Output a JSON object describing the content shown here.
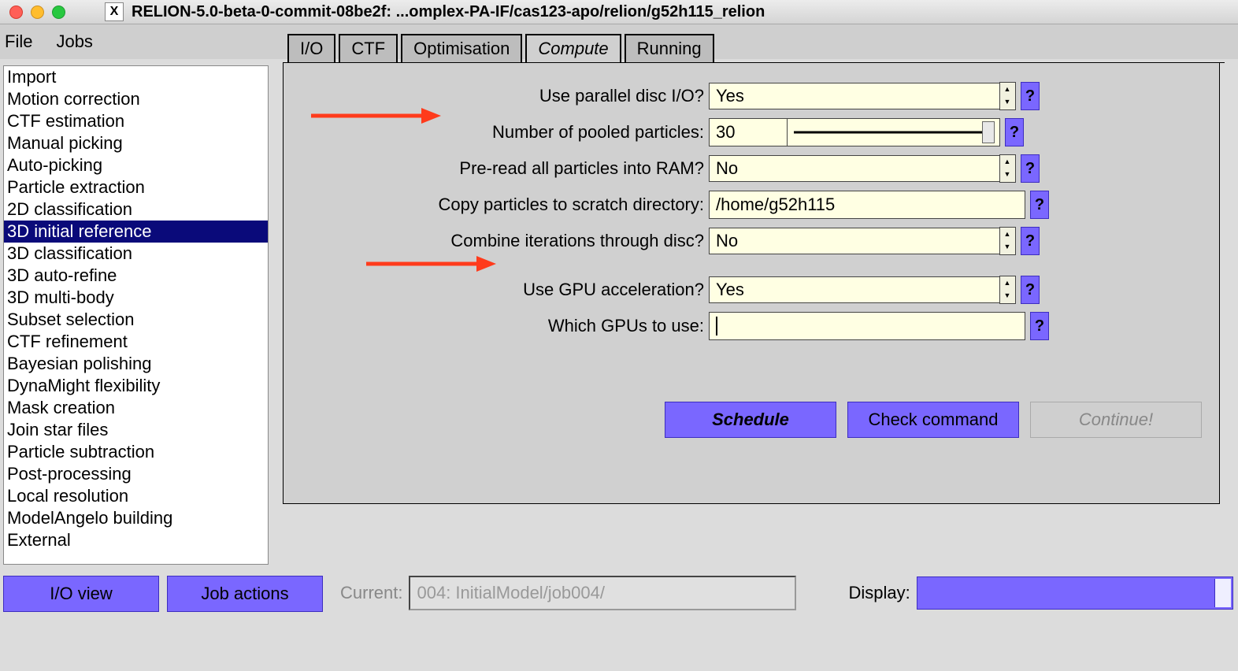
{
  "titlebar": {
    "title": "RELION-5.0-beta-0-commit-08be2f: ...omplex-PA-IF/cas123-apo/relion/g52h115_relion"
  },
  "menubar": {
    "items": [
      "File",
      "Jobs"
    ]
  },
  "jobtypes": {
    "items": [
      "Import",
      "Motion correction",
      "CTF estimation",
      "Manual picking",
      "Auto-picking",
      "Particle extraction",
      "2D classification",
      "3D initial reference",
      "3D classification",
      "3D auto-refine",
      "3D multi-body",
      "Subset selection",
      "CTF refinement",
      "Bayesian polishing",
      "DynaMight flexibility",
      "Mask creation",
      "Join star files",
      "Particle subtraction",
      "Post-processing",
      "Local resolution",
      "ModelAngelo building",
      "External"
    ],
    "selected_index": 7
  },
  "tabs": {
    "items": [
      "I/O",
      "CTF",
      "Optimisation",
      "Compute",
      "Running"
    ],
    "active_index": 3
  },
  "params": {
    "use_parallel_io": {
      "label": "Use parallel disc I/O?",
      "value": "Yes"
    },
    "pooled_particles": {
      "label": "Number of pooled particles:",
      "value": "30"
    },
    "preread_ram": {
      "label": "Pre-read all particles into RAM?",
      "value": "No"
    },
    "scratch_dir": {
      "label": "Copy particles to scratch directory:",
      "value": "/home/g52h115"
    },
    "combine_through_disc": {
      "label": "Combine iterations through disc?",
      "value": "No"
    },
    "use_gpu": {
      "label": "Use GPU acceleration?",
      "value": "Yes"
    },
    "which_gpus": {
      "label": "Which GPUs to use:",
      "value": ""
    }
  },
  "buttons": {
    "schedule": "Schedule",
    "check_command": "Check command",
    "continue": "Continue!",
    "io_view": "I/O view",
    "job_actions": "Job actions"
  },
  "status": {
    "current_label": "Current:",
    "current_value": "004: InitialModel/job004/",
    "display_label": "Display:"
  }
}
